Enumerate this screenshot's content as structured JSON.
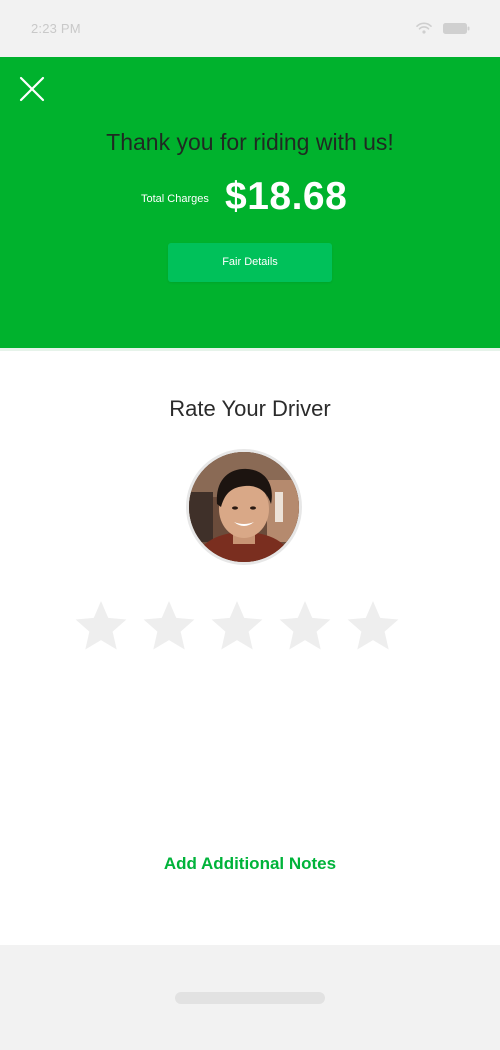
{
  "status_bar": {
    "time": "2:23 PM",
    "wifi_icon": "wifi-icon",
    "battery_icon": "battery-icon"
  },
  "header": {
    "close_icon": "close-icon",
    "title": "Thank you for riding with us!",
    "total_label": "Total Charges",
    "total_amount": "$18.68",
    "fair_details_label": "Fair Details",
    "background_color": "#00b22d",
    "button_color": "#00c15a"
  },
  "rating": {
    "title": "Rate Your Driver",
    "avatar_icon": "driver-avatar",
    "stars_total": 5,
    "stars_selected": 0,
    "star_color": "#eeeeee"
  },
  "notes": {
    "link_label": "Add Additional Notes",
    "link_color": "#00b33a"
  }
}
